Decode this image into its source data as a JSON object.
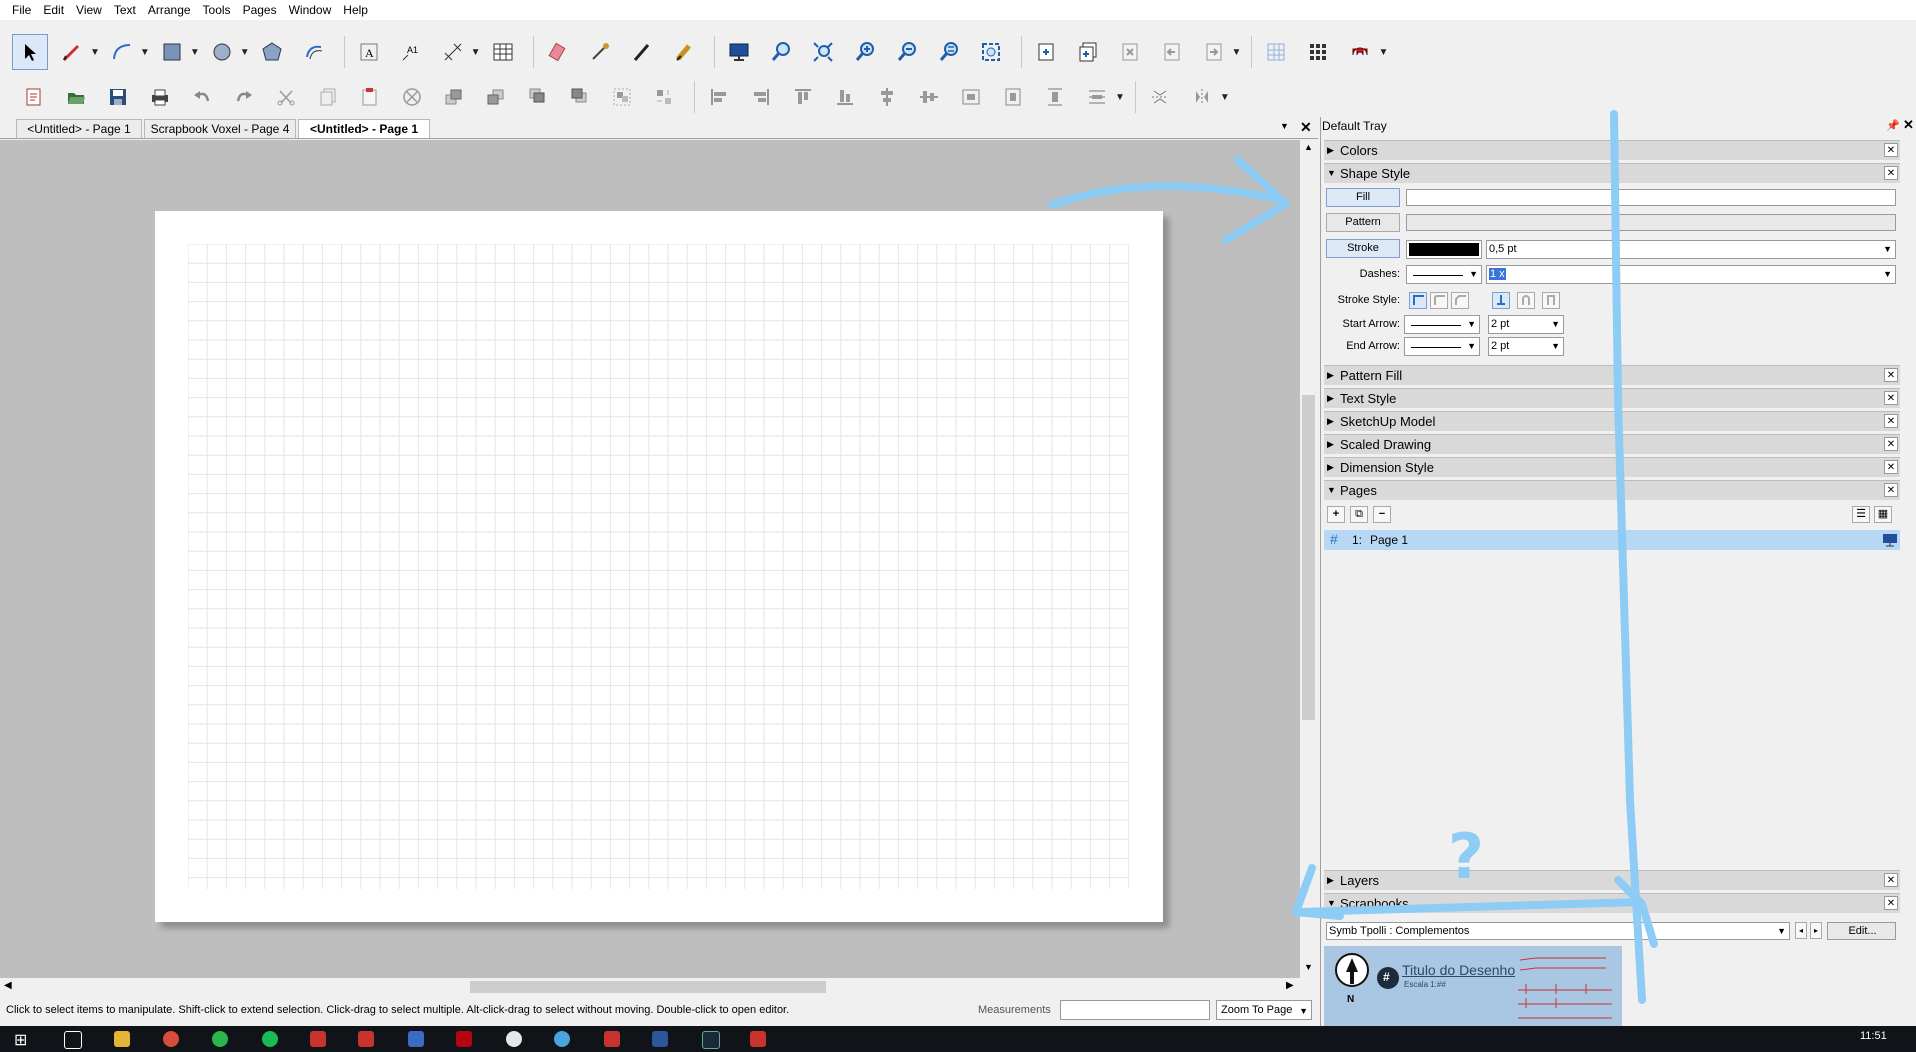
{
  "window": {
    "title": "LayOut"
  },
  "menu": [
    "File",
    "Edit",
    "View",
    "Text",
    "Arrange",
    "Tools",
    "Pages",
    "Window",
    "Help"
  ],
  "toolbar1": {
    "icons": [
      "select-icon",
      "pencil-icon",
      "arc-icon",
      "rectangle-icon",
      "circle-icon",
      "polygon-icon",
      "offset-icon",
      "text-icon",
      "label-icon",
      "dimension-icon",
      "table-icon",
      "eraser-icon",
      "eyedropper-icon",
      "split-icon",
      "join-icon",
      "presentation-icon",
      "zoom-icon",
      "zoom-window-icon",
      "zoom-in-icon",
      "zoom-out-icon",
      "zoom-100-icon",
      "zoom-extents-icon",
      "add-page-icon",
      "duplicate-page-icon",
      "delete-page-icon",
      "previous-page-icon",
      "next-page-icon",
      "grid-icon",
      "snap-grid-icon",
      "object-snap-icon"
    ]
  },
  "doc_tabs": [
    "<Untitled> - Page 1",
    "Scrapbook Voxel - Page 4",
    "<Untitled> - Page 1"
  ],
  "status": {
    "hint": "Click to select items to manipulate. Shift-click to extend selection. Click-drag to select multiple. Alt-click-drag to select without moving. Double-click to open editor.",
    "measurements_label": "Measurements",
    "measurements_value": "",
    "zoom": "Zoom To Page"
  },
  "tray": {
    "title": "Default Tray",
    "panels": [
      "Colors",
      "Shape Style",
      "Pattern Fill",
      "Text Style",
      "SketchUp Model",
      "Scaled Drawing",
      "Dimension Style",
      "Pages",
      "Layers",
      "Scrapbooks"
    ],
    "shape_style": {
      "fill_label": "Fill",
      "pattern_label": "Pattern",
      "stroke_label": "Stroke",
      "stroke_width": "0,5 pt",
      "dashes_label": "Dashes:",
      "dashes_scale": "1 x",
      "stroke_style_label": "Stroke Style:",
      "start_arrow_label": "Start Arrow:",
      "start_arrow_size": "2 pt",
      "end_arrow_label": "End Arrow:",
      "end_arrow_size": "2 pt",
      "stroke_color": "#000000"
    },
    "pages": {
      "items": [
        {
          "number": "1:",
          "name": "Page 1"
        }
      ]
    },
    "scrapbooks": {
      "selected": "Symb Tpolli : Complementos",
      "edit_label": "Edit...",
      "preview_title": "Titulo do Desenho",
      "preview_sub": "Escala 1:##",
      "preview_n": "N",
      "preview_hash": "#"
    }
  },
  "taskbar": {
    "clock": "11:51"
  },
  "annotation": {
    "question": "?",
    "color": "#8dccf5"
  }
}
